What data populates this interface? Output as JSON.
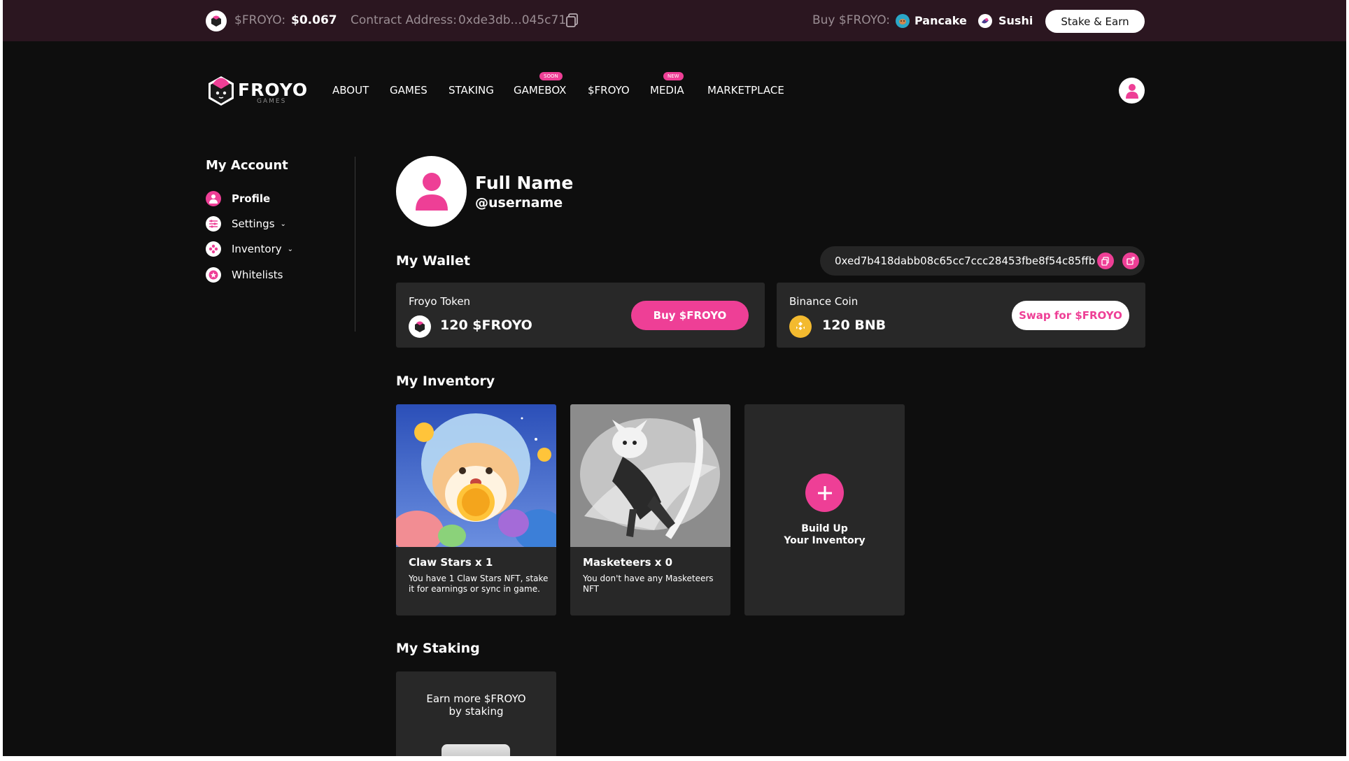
{
  "topbar": {
    "price_label": "$FROYO:",
    "price": "$0.067",
    "contract_label": "Contract Address:",
    "contract": "0xde3db...045c71a",
    "buy_label": "Buy $FROYO:",
    "pancake": "Pancake",
    "sushi": "Sushi",
    "stake_button": "Stake & Earn"
  },
  "logo": {
    "name": "FROYO",
    "sub": "GAMES"
  },
  "nav": {
    "items": [
      "ABOUT",
      "GAMES",
      "STAKING",
      "GAMEBOX",
      "$FROYO",
      "MEDIA",
      "MARKETPLACE"
    ],
    "badge_soon": "SOON",
    "badge_new": "NEW"
  },
  "sidebar": {
    "title": "My Account",
    "items": [
      {
        "label": "Profile",
        "icon": "user-icon"
      },
      {
        "label": "Settings",
        "icon": "sliders-icon"
      },
      {
        "label": "Inventory",
        "icon": "gamepad-icon"
      },
      {
        "label": "Whitelists",
        "icon": "star-icon"
      }
    ]
  },
  "profile": {
    "full_name": "Full Name",
    "username": "@username"
  },
  "wallet": {
    "title": "My Wallet",
    "address": "0xed7b418dabb08c65cc7ccc28453fbe8f54c85ffb",
    "froyo": {
      "label": "Froyo Token",
      "amount": "120 $FROYO",
      "button": "Buy $FROYO"
    },
    "bnb": {
      "label": "Binance Coin",
      "amount": "120 BNB",
      "button": "Swap for $FROYO"
    }
  },
  "inventory": {
    "title": "My Inventory",
    "items": [
      {
        "title": "Claw Stars x 1",
        "desc": "You have 1 Claw Stars NFT, stake it for earnings or sync in game."
      },
      {
        "title": "Masketeers x 0",
        "desc": "You don't have any Masketeers NFT"
      }
    ],
    "add_line1": "Build Up",
    "add_line2": "Your Inventory"
  },
  "staking": {
    "title": "My Staking",
    "line1": "Earn more $FROYO",
    "line2": "by staking"
  },
  "colors": {
    "accent": "#ee3f96",
    "topbar": "#2b1620",
    "background": "#0e0e0e",
    "card": "#282828"
  }
}
